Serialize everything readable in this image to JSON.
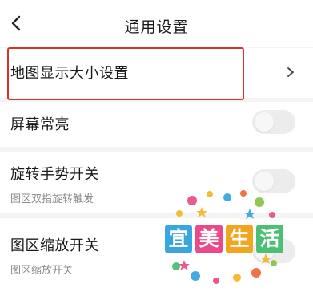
{
  "header": {
    "title": "通用设置",
    "back_icon": "chevron-left-icon"
  },
  "rows": [
    {
      "label": "地图显示大小设置",
      "control": "chevron-right-icon",
      "highlighted": true
    },
    {
      "label": "屏幕常亮",
      "control": "toggle",
      "on": false
    },
    {
      "label": "旋转手势开关",
      "sublabel": "图区双指旋转触发",
      "control": "toggle",
      "on": false
    },
    {
      "label": "图区缩放开关",
      "sublabel": "图区缩放开关",
      "control": "toggle",
      "on": false
    }
  ],
  "watermark": {
    "characters": [
      "宜",
      "美",
      "生",
      "活"
    ],
    "colors": [
      "#3aa6e0",
      "#e94b8a",
      "#f2a51f",
      "#4bbf73"
    ]
  },
  "colors": {
    "highlight": "#d9302c",
    "background": "#f4f4f4",
    "toggle_off": "#ececec"
  }
}
